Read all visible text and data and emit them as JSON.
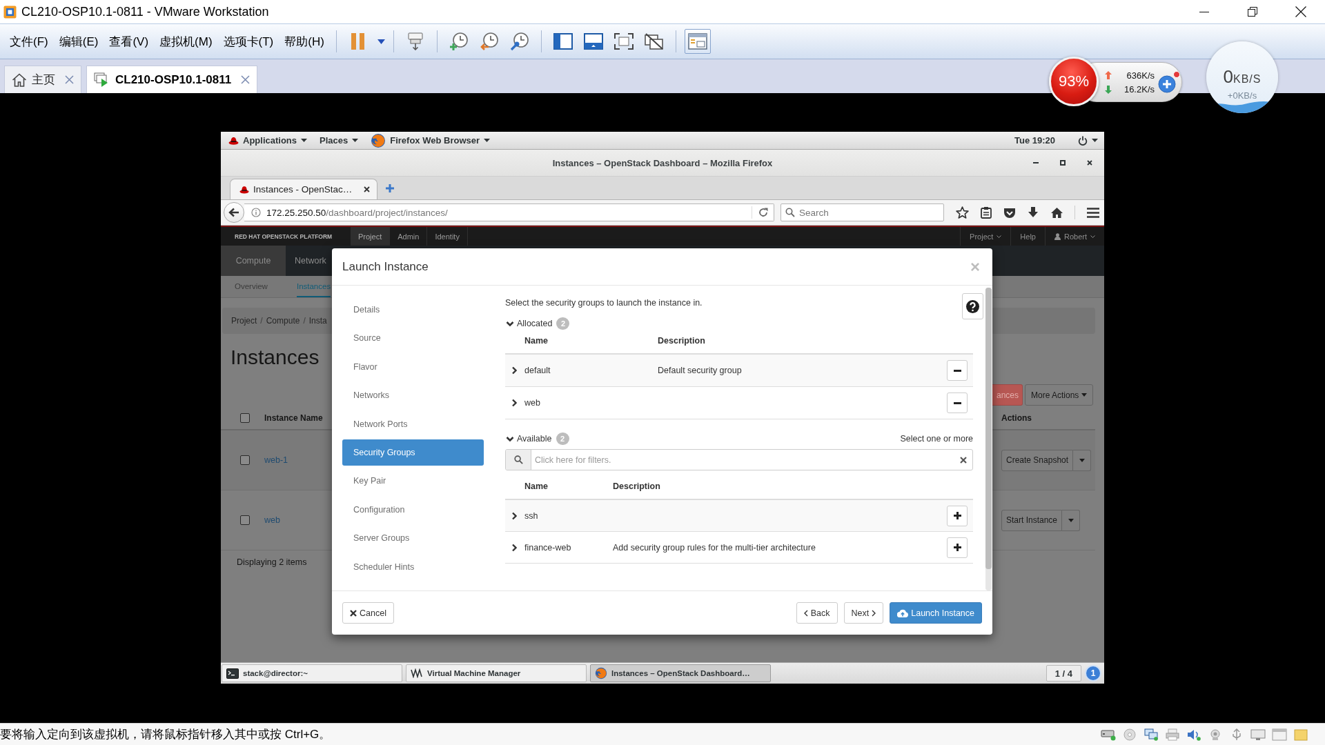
{
  "vmware": {
    "title": "CL210-OSP10.1-0811 - VMware Workstation",
    "menus": [
      "文件(F)",
      "编辑(E)",
      "查看(V)",
      "虚拟机(M)",
      "选项卡(T)",
      "帮助(H)"
    ],
    "toolbar": [
      {
        "on": false
      },
      {
        "on": false
      },
      {
        "on": false
      },
      {
        "on": false
      },
      {
        "on": false
      },
      {
        "on": false
      },
      {
        "on": false
      },
      {
        "on": false
      },
      {
        "on": false
      },
      {
        "on": true
      }
    ],
    "tabs": [
      {
        "label": "主页",
        "kind": "home",
        "selected": false
      },
      {
        "label": "CL210-OSP10.1-0811",
        "kind": "vm",
        "selected": true
      }
    ],
    "status": "要将输入定向到该虚拟机，请将鼠标指针移入其中或按 Ctrl+G。"
  },
  "speed_widget": {
    "usage": "93%",
    "upload": "636K/s",
    "download": "16.2K/s"
  },
  "net_ball": {
    "value": "0",
    "unit": "KB/S",
    "delta": "+0KB/s"
  },
  "gnome_top_bar": {
    "menus": [
      {
        "label": "Applications",
        "kind": "apps"
      },
      {
        "label": "Places",
        "kind": "places"
      },
      {
        "label": "Firefox Web Browser",
        "kind": "app"
      }
    ],
    "clock": "Tue 19:20"
  },
  "firefox": {
    "title": "Instances – OpenStack Dashboard – Mozilla Firefox",
    "tabs": [
      {
        "label": "Instances - OpenStac…",
        "selected": true
      }
    ],
    "url": {
      "host": "172.25.250.50",
      "path": "/dashboard/project/instances/"
    },
    "search": {
      "placeholder": "Search"
    }
  },
  "dashboard": {
    "brand": "RED HAT OPENSTACK PLATFORM",
    "nav": [
      {
        "label": "Project",
        "selected": true
      },
      {
        "label": "Admin",
        "selected": false
      },
      {
        "label": "Identity",
        "selected": false
      }
    ],
    "user_menu": [
      {
        "label": "Project",
        "kind": "dropdown"
      },
      {
        "label": "Help",
        "kind": "link"
      },
      {
        "label": "Robert",
        "kind": "user"
      }
    ],
    "panels": [
      {
        "label": "Compute",
        "selected": true
      },
      {
        "label": "Network",
        "selected": false
      }
    ],
    "subnav": [
      {
        "label": "Overview",
        "selected": false
      },
      {
        "label": "Instances",
        "selected": true
      }
    ],
    "breadcrumb": {
      "items": [
        "Project",
        "Compute",
        "Insta"
      ],
      "separator": "/"
    },
    "heading": "Instances",
    "actions": [
      {
        "label": "ances",
        "kind": "danger"
      },
      {
        "label": "More Actions",
        "kind": "dropdown"
      }
    ],
    "table": {
      "all_checked": false,
      "columns": [
        "Instance Name",
        "Actions"
      ],
      "rows": [
        {
          "name": "web-1",
          "checked": false,
          "action": "Create Snapshot"
        },
        {
          "name": "web",
          "checked": false,
          "action": "Start Instance"
        }
      ],
      "footer": "Displaying 2 items"
    }
  },
  "modal": {
    "title": "Launch Instance",
    "close": "×",
    "steps": [
      {
        "label": "Details",
        "selected": false
      },
      {
        "label": "Source",
        "selected": false
      },
      {
        "label": "Flavor",
        "selected": false
      },
      {
        "label": "Networks",
        "selected": false
      },
      {
        "label": "Network Ports",
        "selected": false
      },
      {
        "label": "Security Groups",
        "selected": true
      },
      {
        "label": "Key Pair",
        "selected": false
      },
      {
        "label": "Configuration",
        "selected": false
      },
      {
        "label": "Server Groups",
        "selected": false
      },
      {
        "label": "Scheduler Hints",
        "selected": false
      }
    ],
    "intro": "Select the security groups to launch the instance in.",
    "sections": [
      {
        "label": "Allocated",
        "count": "2",
        "expanded": true,
        "kind": "allocated",
        "columns": [
          "Name",
          "Description"
        ],
        "rows": [
          {
            "name": "default",
            "description": "Default security group",
            "expanded": false
          },
          {
            "name": "web",
            "expanded": false
          }
        ]
      },
      {
        "label": "Available",
        "count": "2",
        "expanded": true,
        "kind": "available",
        "hint": "Select one or more",
        "filter": {
          "placeholder": "Click here for filters."
        },
        "columns": [
          "Name",
          "Description"
        ],
        "rows": [
          {
            "name": "ssh",
            "expanded": false
          },
          {
            "name": "finance-web",
            "description": "Add security group rules for the multi-tier architecture",
            "expanded": false
          }
        ]
      }
    ],
    "buttons": [
      {
        "label": "Cancel",
        "kind": "cancel"
      },
      {
        "label": "Back",
        "kind": "back"
      },
      {
        "label": "Next",
        "kind": "next"
      },
      {
        "label": "Launch Instance",
        "kind": "launch"
      }
    ]
  },
  "taskbar": {
    "windows": [
      {
        "label": "stack@director:~",
        "kind": "terminal",
        "selected": false
      },
      {
        "label": "Virtual Machine Manager",
        "kind": "vmm",
        "selected": false
      },
      {
        "label": "Instances – OpenStack Dashboard…",
        "kind": "browser",
        "selected": true
      }
    ],
    "workspace": "1 / 4",
    "notifications": "1"
  }
}
